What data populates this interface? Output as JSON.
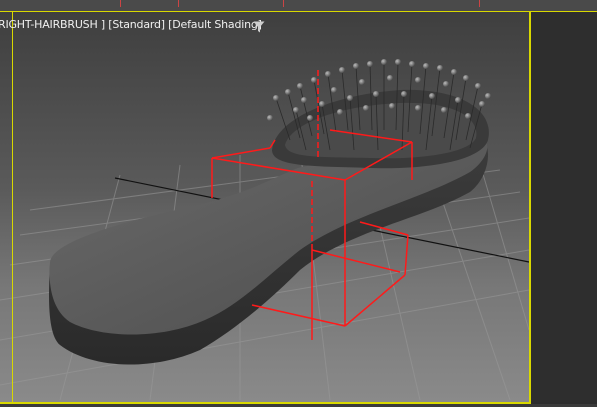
{
  "viewport": {
    "label_view": "RIGHT-HAIRBRUSH ]",
    "label_prefix": "[",
    "label_standard": "[Standard]",
    "label_shading": "[Default Shading]",
    "filter_icon": "filter-icon",
    "active_border_color": "#d8d800",
    "selection_color": "#ff0000"
  }
}
